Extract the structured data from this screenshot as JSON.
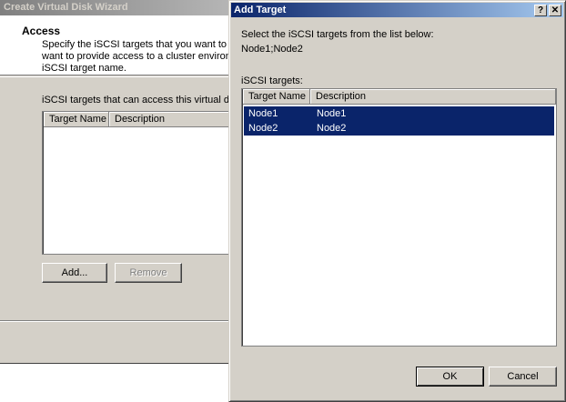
{
  "wizard": {
    "title": "Create Virtual Disk Wizard",
    "header_title": "Access",
    "header_desc": [
      "Specify the iSCSI targets that you want to b",
      "want to provide access to a cluster environm",
      "iSCSI target name."
    ],
    "list_label": "iSCSI targets that can access this virtual dis",
    "columns": [
      "Target Name",
      "Description"
    ],
    "add_label": "Add...",
    "remove_label": "Remove"
  },
  "dialog": {
    "title": "Add Target",
    "help_label": "?",
    "close_label": "✕",
    "instruction": "Select the iSCSI targets from the list below:",
    "selected_text": "Node1;Node2",
    "targets_label": "iSCSI targets:",
    "columns": [
      "Target Name",
      "Description"
    ],
    "rows": [
      {
        "name": "Node1",
        "description": "Node1"
      },
      {
        "name": "Node2",
        "description": "Node2"
      }
    ],
    "ok_label": "OK",
    "cancel_label": "Cancel"
  }
}
